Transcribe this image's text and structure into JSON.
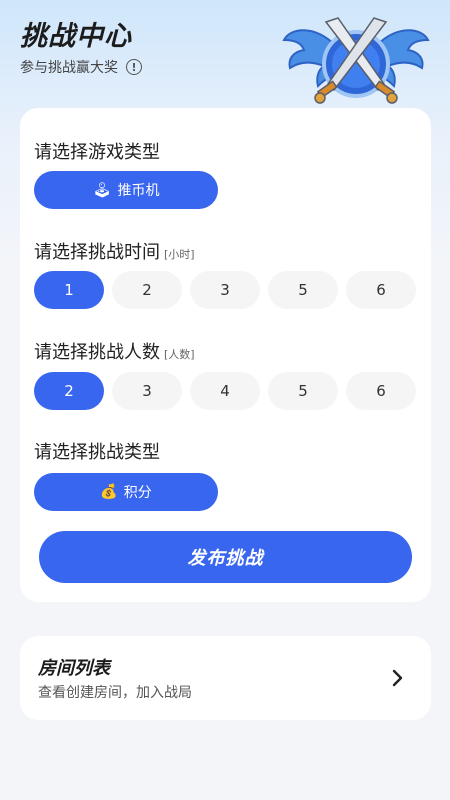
{
  "header": {
    "title": "挑战中心",
    "subtitle": "参与挑战赢大奖",
    "info_icon": "!",
    "emblem_icon": "crossed-swords-shield-emblem"
  },
  "form": {
    "game_type": {
      "label": "请选择游戏类型",
      "selected": "推币机",
      "icon": "joystick-icon"
    },
    "time": {
      "label": "请选择挑战时间",
      "unit": "[小时]",
      "options": [
        "1",
        "2",
        "3",
        "5",
        "6"
      ],
      "selected": "1"
    },
    "people": {
      "label": "请选择挑战人数",
      "unit": "[人数]",
      "options": [
        "2",
        "3",
        "4",
        "5",
        "6"
      ],
      "selected": "2"
    },
    "challenge_type": {
      "label": "请选择挑战类型",
      "selected": "积分",
      "icon": "coins-icon"
    },
    "publish_label": "发布挑战"
  },
  "room_list": {
    "title": "房间列表",
    "subtitle": "查看创建房间，加入战局"
  },
  "colors": {
    "accent": "#3866ef",
    "card": "#ffffff",
    "option_bg": "#f5f5f5"
  }
}
